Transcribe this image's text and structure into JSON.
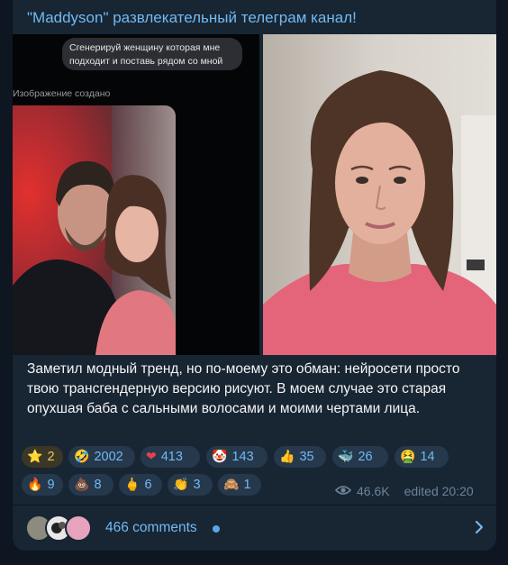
{
  "channel_title": "\"Maddyson\" развлекательный телеграм канал!",
  "left_image": {
    "prompt_bubble": "Сгенерируй женщину которая мне подходит и поставь рядом со мной",
    "created_label": "Изображение создано"
  },
  "caption": "Заметил модный тренд, но по-моему это обман: нейросети просто твою трансгендерную версию рисуют. В моем случае это старая опухшая баба с сальными волосами и моими чертами лица.",
  "reactions": [
    {
      "emoji": "⭐",
      "count": "2"
    },
    {
      "emoji": "🤣",
      "count": "2002"
    },
    {
      "emoji": "❤",
      "count": "413"
    },
    {
      "emoji": "🤡",
      "count": "143"
    },
    {
      "emoji": "👍",
      "count": "35"
    },
    {
      "emoji": "🐳",
      "count": "26"
    },
    {
      "emoji": "🤮",
      "count": "14"
    },
    {
      "emoji": "🔥",
      "count": "9"
    },
    {
      "emoji": "💩",
      "count": "8"
    },
    {
      "emoji": "🖕",
      "count": "6"
    },
    {
      "emoji": "👏",
      "count": "3"
    },
    {
      "emoji": "🙈",
      "count": "1"
    }
  ],
  "views": "46.6K",
  "edited_label": "edited 20:20",
  "comments": {
    "label": "466 comments"
  },
  "colors": {
    "accent": "#71baf2",
    "card_bg": "#182533",
    "page_bg": "#0e1621"
  }
}
